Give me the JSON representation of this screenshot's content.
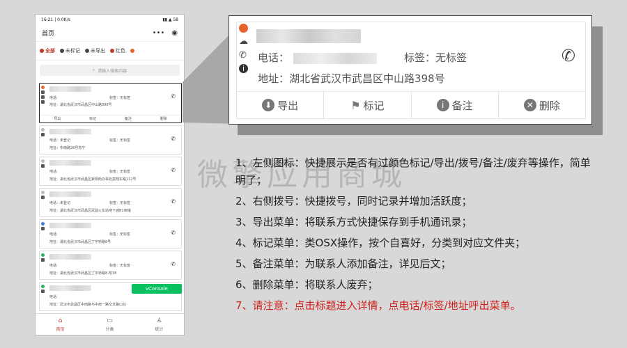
{
  "phone": {
    "status_time": "16:21 | 0.0K/s",
    "status_right": "▮▮ ▲ 58",
    "title": "首页",
    "capsule_more": "•••",
    "capsule_close": "◉",
    "filters": [
      {
        "label": "全部",
        "color": "#c0392b"
      },
      {
        "label": "未标记",
        "color": "#444444"
      },
      {
        "label": "未导出",
        "color": "#444444"
      },
      {
        "label": "红色",
        "color": "#c0392b"
      }
    ],
    "search_placeholder": "请输入搜索内容",
    "cards": [
      {
        "phone_label": "电话:",
        "tag": "标签：无标签",
        "address": "地址：湖北省武汉市武昌区中山路398号",
        "dot": "#e8632b",
        "actions": [
          "导出",
          "标记",
          "备注",
          "删除"
        ]
      },
      {
        "phone_label": "电话：未登记",
        "tag": "标签：无标签",
        "address": "地址：中南路26号苏宁",
        "dot": "#bbbbbb"
      },
      {
        "phone_label": "电话:",
        "tag": "标签：无标签",
        "address": "地址：湖北省武汉市武昌区紫阳街办事处莫翔东路112号",
        "dot": "#bbbbbb"
      },
      {
        "phone_label": "电话：未登记",
        "tag": "标签：无标签",
        "address": "地址：湖北省武汉市武昌区武昌火车站地下城B1商铺",
        "dot": "#bbbbbb"
      },
      {
        "phone_label": "电话:",
        "tag": "标签：无标签",
        "address": "地址：湖北省武汉市武昌区丁字桥路8号",
        "dot": "#3b7dd8"
      },
      {
        "phone_label": "电话:",
        "tag": "标签：无标签",
        "address": "地址：湖北省武汉市武昌区丁字桥路8-附38",
        "dot": "#27ae60"
      },
      {
        "phone_label": "电话:",
        "tag": "",
        "address": "地址：武汉市武昌区中南路与中南一路交叉路口往",
        "dot": "#27ae60"
      }
    ],
    "vconsole": "vConsole",
    "tabs": [
      {
        "label": "首页",
        "icon": "⌂"
      },
      {
        "label": "分类",
        "icon": "▭"
      },
      {
        "label": "统计",
        "icon": "♙"
      }
    ]
  },
  "zoom": {
    "phone_label": "电话：",
    "tag": "标签：无标签",
    "address": "地址：湖北省武汉市武昌区中山路398号",
    "actions": [
      {
        "label": "导出",
        "icon": "⬇"
      },
      {
        "label": "标记",
        "icon": "⚑"
      },
      {
        "label": "备注",
        "icon": "i"
      },
      {
        "label": "删除",
        "icon": "✕"
      }
    ]
  },
  "watermark": "微擎应用商城",
  "description": [
    {
      "text": "1、左侧图标：快捷展示是否有过颜色标记/导出/拨号/备注/废弃等操作，简单明了；",
      "color": "#222222"
    },
    {
      "text": "2、右侧拨号：快捷拨号，同时记录并增加活跃度；",
      "color": "#222222"
    },
    {
      "text": "3、导出菜单：将联系方式快捷保存到手机通讯录；",
      "color": "#222222"
    },
    {
      "text": "4、标记菜单：类OSX操作，按个自喜好，分类到对应文件夹；",
      "color": "#222222"
    },
    {
      "text": "5、备注菜单：为联系人添加备注，详见后文；",
      "color": "#222222"
    },
    {
      "text": "6、删除菜单：将联系人废弃；",
      "color": "#222222"
    },
    {
      "text": "7、请注意：点击标题进入详情，点电话/标签/地址呼出菜单。",
      "color": "#d0201b"
    }
  ]
}
